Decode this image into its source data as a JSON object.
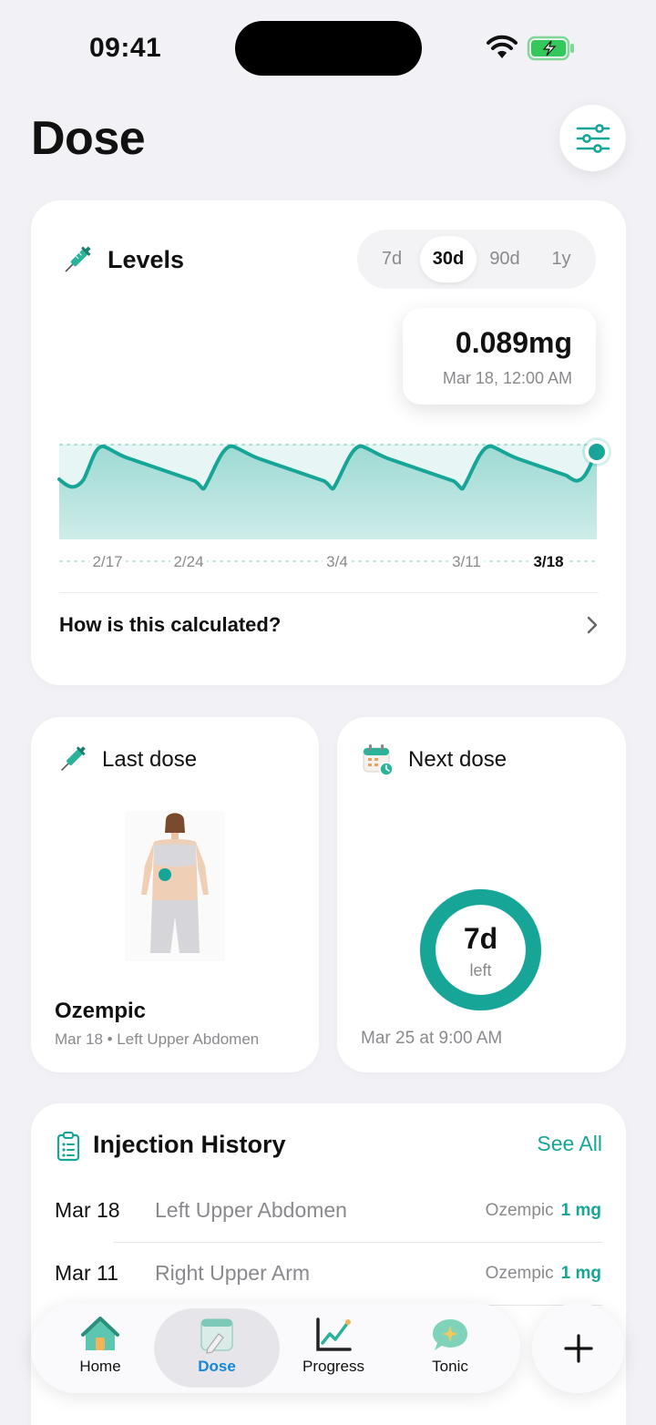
{
  "status_bar": {
    "time": "09:41"
  },
  "header": {
    "title": "Dose"
  },
  "levels": {
    "title": "Levels",
    "ranges": [
      "7d",
      "30d",
      "90d",
      "1y"
    ],
    "active_range": "30d",
    "tooltip_value": "0.089mg",
    "tooltip_date": "Mar 18, 12:00 AM",
    "x_labels": [
      "2/17",
      "2/24",
      "3/4",
      "3/11",
      "3/18"
    ],
    "calc_link": "How is this calculated?"
  },
  "last_dose": {
    "title": "Last dose",
    "medication": "Ozempic",
    "detail": "Mar 18 • Left Upper Abdomen"
  },
  "next_dose": {
    "title": "Next dose",
    "days": "7d",
    "days_unit": "left",
    "progress": 1.0,
    "when": "Mar 25 at 9:00 AM"
  },
  "history": {
    "title": "Injection History",
    "see_all": "See All",
    "rows": [
      {
        "date": "Mar 18",
        "site": "Left Upper Abdomen",
        "med": "Ozempic",
        "amount": "1 mg"
      },
      {
        "date": "Mar 11",
        "site": "Right Upper Arm",
        "med": "Ozempic",
        "amount": "1 mg"
      }
    ]
  },
  "tab_bar": {
    "items": [
      {
        "label": "Home",
        "icon": "house-icon"
      },
      {
        "label": "Dose",
        "icon": "notebook-icon"
      },
      {
        "label": "Progress",
        "icon": "chart-icon"
      },
      {
        "label": "Tonic",
        "icon": "chat-sparkle-icon"
      }
    ],
    "active": "Dose"
  },
  "colors": {
    "accent": "#17a597",
    "tab_active": "#1686d6"
  }
}
